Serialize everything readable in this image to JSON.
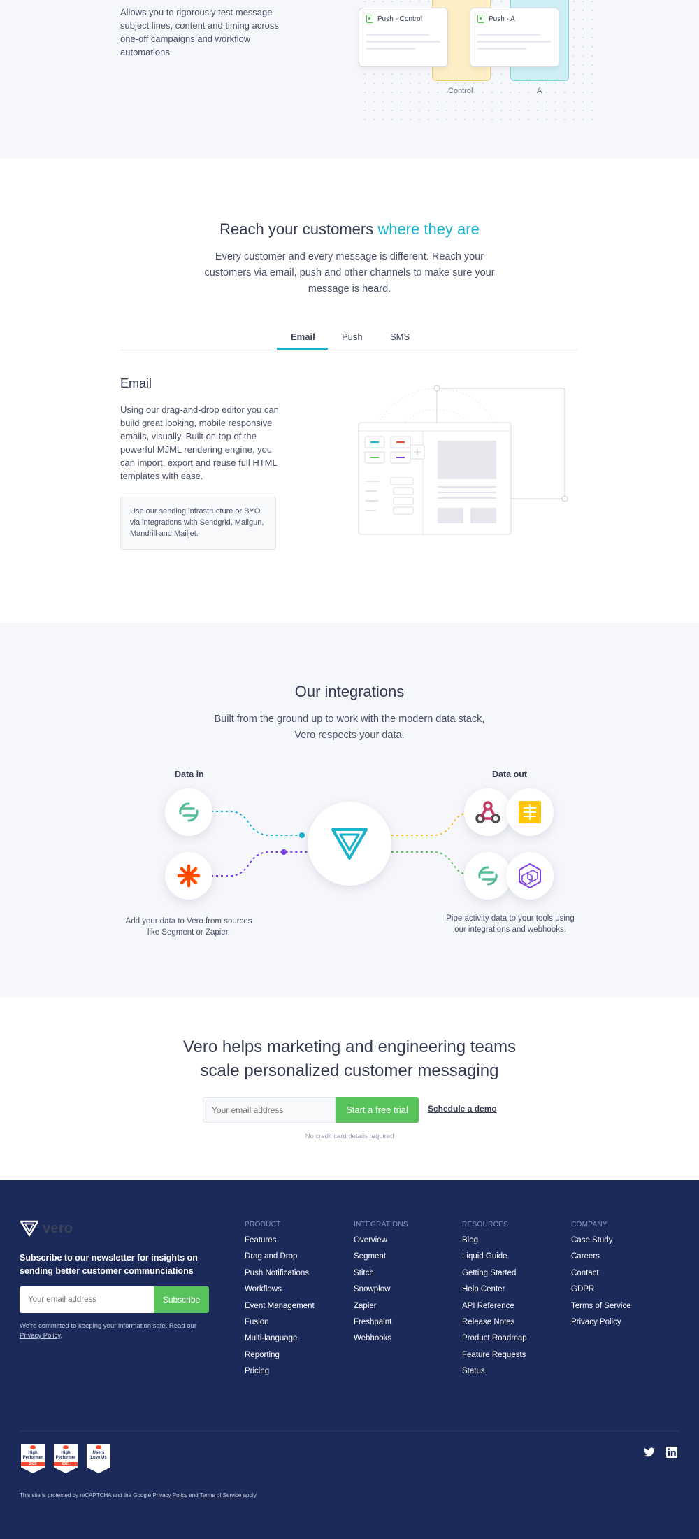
{
  "ab_test": {
    "description": "Allows you to rigorously test message subject lines, content and timing across one-off campaigns and workflow automations.",
    "card_control": "Push - Control",
    "card_a": "Push - A",
    "label_control": "Control",
    "label_a": "A"
  },
  "reach": {
    "title_prefix": "Reach your customers ",
    "title_accent": "where they are",
    "subtitle": "Every customer and every message is different. Reach your customers via email, push and other channels to make sure your message is heard.",
    "tabs": [
      "Email",
      "Push",
      "SMS"
    ],
    "active_tab": "Email",
    "panel_title": "Email",
    "panel_text_before": "Using our drag-and-drop editor you can build great looking, mobile responsive emails, visually. Built on top of the powerful ",
    "panel_link": "MJML",
    "panel_text_after": " rendering engine, you can import, export and reuse full HTML templates with ease.",
    "note": "Use our sending infrastructure or BYO via integrations with Sendgrid, Mailgun, Mandrill and Mailjet."
  },
  "integrations": {
    "title": "Our integrations",
    "subtitle": "Built from the ground up to work with the modern data stack, Vero respects your data.",
    "data_in_label": "Data in",
    "data_out_label": "Data out",
    "data_in_caption": "Add your data to Vero from sources like Segment or Zapier.",
    "data_out_caption": "Pipe activity data to your tools using our integrations and webhooks.",
    "icons": {
      "in": [
        "segment-icon",
        "zapier-icon"
      ],
      "out": [
        "webhooks-icon",
        "mixpanel-icon",
        "segment-icon",
        "snowplow-icon"
      ],
      "center": "vero-logo-icon"
    },
    "colors": {
      "teal": "#18b2c9",
      "purple": "#7d3ce0",
      "yellow": "#f5c233",
      "green": "#58c25b",
      "zapier": "#ff4a00",
      "segment": "#52bd94"
    }
  },
  "cta": {
    "title_line1": "Vero helps marketing and engineering teams",
    "title_line2": "scale personalized customer messaging",
    "email_placeholder": "Your email address",
    "trial_button": "Start a free trial",
    "demo_link": "Schedule a demo",
    "note": "No credit card details required"
  },
  "footer": {
    "logo_text": "vero",
    "newsletter_title": "Subscribe to our newsletter for insights on sending better customer communciations",
    "email_placeholder": "Your email address",
    "subscribe_button": "Subscribe",
    "privacy_before": "We're committed to keeping your information safe. Read our ",
    "privacy_link": "Privacy Policy",
    "privacy_after": ".",
    "columns": [
      {
        "heading": "PRODUCT",
        "links": [
          "Features",
          "Drag and Drop",
          "Push Notifications",
          "Workflows",
          "Event Management",
          "Fusion",
          "Multi-language",
          "Reporting",
          "Pricing"
        ]
      },
      {
        "heading": "INTEGRATIONS",
        "links": [
          "Overview",
          "Segment",
          "Stitch",
          "Snowplow",
          "Zapier",
          "Freshpaint",
          "Webhooks"
        ]
      },
      {
        "heading": "RESOURCES",
        "links": [
          "Blog",
          "Liquid Guide",
          "Getting Started",
          "Help Center",
          "API Reference",
          "Release Notes",
          "Product Roadmap",
          "Feature Requests",
          "Status"
        ]
      },
      {
        "heading": "COMPANY",
        "links": [
          "Case Study",
          "Careers",
          "Contact",
          "GDPR",
          "Terms of Service",
          "Privacy Policy"
        ]
      }
    ],
    "badges": [
      {
        "line1": "High",
        "line2": "Performer",
        "year": "2020"
      },
      {
        "line1": "High",
        "line2": "Performer",
        "year": "2021"
      },
      {
        "line1": "Users",
        "line2": "Love Us",
        "year": ""
      }
    ],
    "recaptcha_before": "This site is protected by reCAPTCHA and the Google ",
    "recaptcha_privacy": "Privacy Policy",
    "recaptcha_and": " and ",
    "recaptcha_terms": "Terms of Service",
    "recaptcha_after": " apply.",
    "social": [
      "twitter-icon",
      "linkedin-icon"
    ]
  }
}
